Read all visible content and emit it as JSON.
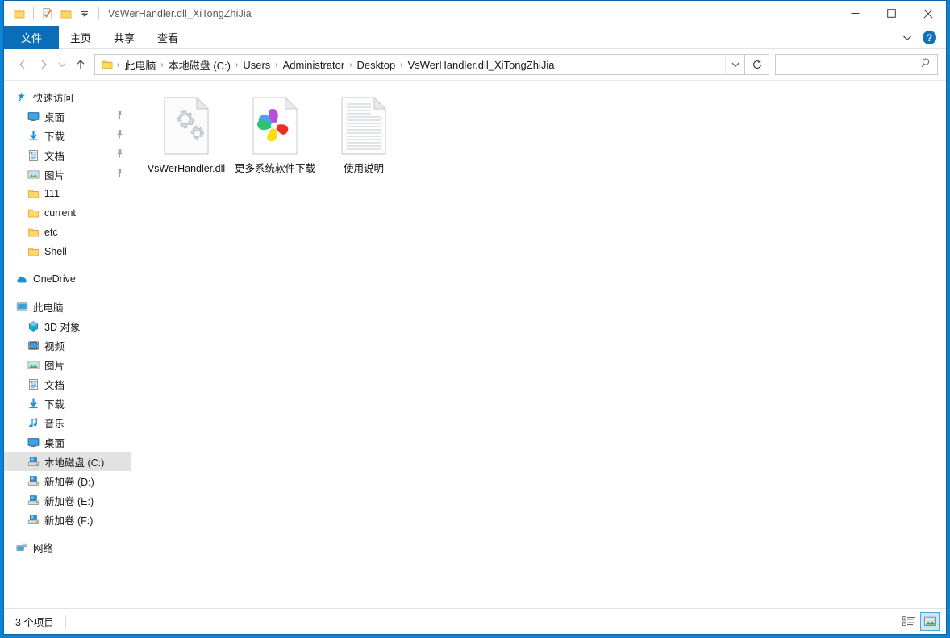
{
  "window": {
    "title": "VsWerHandler.dll_XiTongZhiJia",
    "accent_color": "#0b84d8",
    "ribbon_file_color": "#0b6cb8",
    "selection_color": "#e2e2e2"
  },
  "quick_access_toolbar": {
    "items": [
      {
        "name": "folder-icon",
        "label": ""
      },
      {
        "name": "properties-icon",
        "label": ""
      },
      {
        "name": "new-folder-icon",
        "label": ""
      },
      {
        "name": "customize-dropdown-icon",
        "label": ""
      }
    ]
  },
  "caption": {
    "minimize": "—",
    "maximize": "☐",
    "close": "✕"
  },
  "ribbon": {
    "tabs": [
      {
        "label": "文件",
        "active": true
      },
      {
        "label": "主页",
        "active": false
      },
      {
        "label": "共享",
        "active": false
      },
      {
        "label": "查看",
        "active": false
      }
    ],
    "collapse_label": "⌄",
    "help_label": "?"
  },
  "address_bar": {
    "back_label": "←",
    "forward_label": "→",
    "recent_label": "⌄",
    "up_label": "↑",
    "breadcrumbs": [
      "此电脑",
      "本地磁盘 (C:)",
      "Users",
      "Administrator",
      "Desktop",
      "VsWerHandler.dll_XiTongZhiJia"
    ],
    "separator": "›",
    "dropdown_label": "⌄",
    "refresh_label": "↻"
  },
  "search": {
    "value": "",
    "placeholder": "",
    "icon": "search-icon"
  },
  "sidebar": {
    "groups": [
      {
        "name": "quick-access",
        "header": {
          "label": "快速访问",
          "icon": "pin-star-icon",
          "level": 0
        },
        "items": [
          {
            "label": "桌面",
            "icon": "desktop-icon",
            "pinned": true,
            "level": 1
          },
          {
            "label": "下载",
            "icon": "downloads-icon",
            "pinned": true,
            "level": 1
          },
          {
            "label": "文档",
            "icon": "documents-icon",
            "pinned": true,
            "level": 1
          },
          {
            "label": "图片",
            "icon": "pictures-icon",
            "pinned": true,
            "level": 1
          },
          {
            "label": "111",
            "icon": "folder-icon",
            "pinned": false,
            "level": 1
          },
          {
            "label": "current",
            "icon": "folder-icon",
            "pinned": false,
            "level": 1
          },
          {
            "label": "etc",
            "icon": "folder-icon",
            "pinned": false,
            "level": 1
          },
          {
            "label": "Shell",
            "icon": "folder-icon",
            "pinned": false,
            "level": 1
          }
        ]
      },
      {
        "name": "onedrive",
        "header": {
          "label": "OneDrive",
          "icon": "cloud-icon",
          "level": 0
        },
        "items": []
      },
      {
        "name": "this-pc",
        "header": {
          "label": "此电脑",
          "icon": "this-pc-icon",
          "level": 0
        },
        "items": [
          {
            "label": "3D 对象",
            "icon": "3d-objects-icon",
            "pinned": false,
            "level": 1
          },
          {
            "label": "视频",
            "icon": "videos-icon",
            "pinned": false,
            "level": 1
          },
          {
            "label": "图片",
            "icon": "pictures-icon",
            "pinned": false,
            "level": 1
          },
          {
            "label": "文档",
            "icon": "documents-icon",
            "pinned": false,
            "level": 1
          },
          {
            "label": "下载",
            "icon": "downloads-icon",
            "pinned": false,
            "level": 1
          },
          {
            "label": "音乐",
            "icon": "music-icon",
            "pinned": false,
            "level": 1
          },
          {
            "label": "桌面",
            "icon": "desktop-icon",
            "pinned": false,
            "level": 1
          },
          {
            "label": "本地磁盘 (C:)",
            "icon": "drive-icon",
            "pinned": false,
            "level": 1,
            "selected": true
          },
          {
            "label": "新加卷 (D:)",
            "icon": "drive-icon",
            "pinned": false,
            "level": 1
          },
          {
            "label": "新加卷 (E:)",
            "icon": "drive-icon",
            "pinned": false,
            "level": 1
          },
          {
            "label": "新加卷 (F:)",
            "icon": "drive-icon",
            "pinned": false,
            "level": 1
          }
        ]
      },
      {
        "name": "network",
        "header": {
          "label": "网络",
          "icon": "network-icon",
          "level": 0
        },
        "items": []
      }
    ]
  },
  "files": [
    {
      "name": "VsWerHandler.dll",
      "icon": "dll-gear-document-icon"
    },
    {
      "name": "更多系统软件下载",
      "icon": "pinwheel-shortcut-icon"
    },
    {
      "name": "使用说明",
      "icon": "text-document-icon"
    }
  ],
  "status_bar": {
    "item_count": "3 个项目",
    "views": [
      {
        "name": "details-view-button",
        "active": false
      },
      {
        "name": "large-icons-view-button",
        "active": true
      }
    ]
  }
}
